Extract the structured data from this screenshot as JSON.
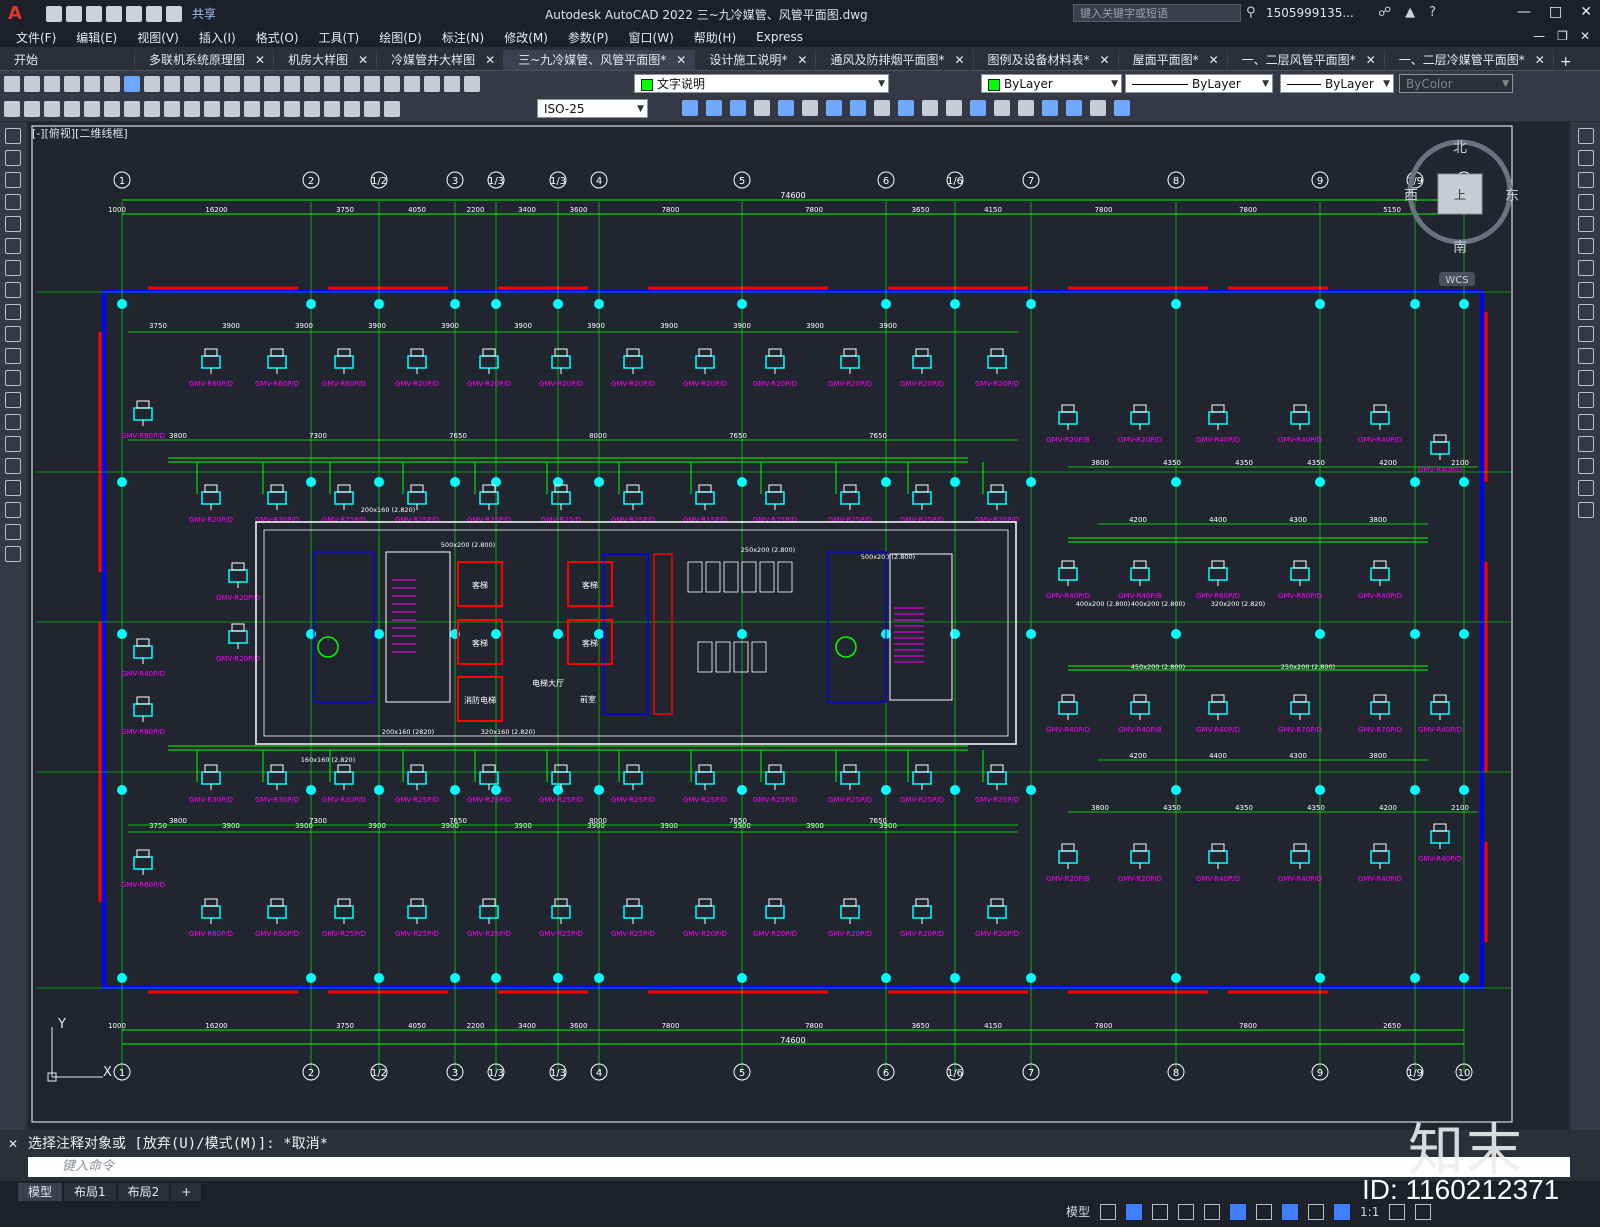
{
  "app": {
    "title": "Autodesk AutoCAD 2022   三~九冷媒管、风管平面图.dwg",
    "share": "共享",
    "search_placeholder": "键入关键字或短语",
    "user": "1505999135...",
    "logo_letter": "A"
  },
  "menu": [
    "文件(F)",
    "编辑(E)",
    "视图(V)",
    "插入(I)",
    "格式(O)",
    "工具(T)",
    "绘图(D)",
    "标注(N)",
    "修改(M)",
    "参数(P)",
    "窗口(W)",
    "帮助(H)",
    "Express"
  ],
  "tabs": [
    {
      "label": "开始",
      "closable": false,
      "active": false
    },
    {
      "label": "多联机系统原理图",
      "closable": true,
      "active": false
    },
    {
      "label": "机房大样图",
      "closable": true,
      "active": false
    },
    {
      "label": "冷媒管井大样图",
      "closable": true,
      "active": false
    },
    {
      "label": "三~九冷媒管、风管平面图*",
      "closable": true,
      "active": true
    },
    {
      "label": "设计施工说明*",
      "closable": true,
      "active": false
    },
    {
      "label": "通风及防排烟平面图*",
      "closable": true,
      "active": false
    },
    {
      "label": "图例及设备材料表*",
      "closable": true,
      "active": false
    },
    {
      "label": "屋面平面图*",
      "closable": true,
      "active": false
    },
    {
      "label": "一、二层风管平面图*",
      "closable": true,
      "active": false
    },
    {
      "label": "一、二层冷媒管平面图*",
      "closable": true,
      "active": false
    }
  ],
  "toolbar": {
    "layer": "文字说明",
    "color": "ByLayer",
    "linetype": "ByLayer",
    "lineweight": "ByLayer",
    "plotstyle": "ByColor",
    "dimstyle": "ISO-25"
  },
  "viewport": {
    "label": "[-][俯视][二维线框]",
    "compass": {
      "n": "北",
      "s": "南",
      "e": "东",
      "w": "西",
      "center": "上",
      "wcs": "WCS"
    }
  },
  "drawing": {
    "axis_labels": [
      "1",
      "2",
      "1/2",
      "3",
      "1/3",
      "1/3",
      "4",
      "5",
      "6",
      "1/6",
      "7",
      "8",
      "9",
      "1/9",
      "10"
    ],
    "top_overall_dim": "74600",
    "top_dims": [
      "1000",
      "16200",
      "3750",
      "4050",
      "2200",
      "3400",
      "3600",
      "7800",
      "7800",
      "3650",
      "4150",
      "7800",
      "7800",
      "5150"
    ],
    "bottom_dims": [
      "1000",
      "16200",
      "3750",
      "4050",
      "2200",
      "3400",
      "3600",
      "7800",
      "7800",
      "3650",
      "4150",
      "7800",
      "7800",
      "2650"
    ],
    "unit_labels_row1": [
      "GMV-R60P/D",
      "GMV-R60P/D",
      "GMV-R60P/D",
      "GMV-R20P/D",
      "GMV-R20P/D",
      "GMV-R20P/D",
      "GMV-R20P/D",
      "GMV-R20P/D",
      "GMV-R20P/D",
      "GMV-R20P/D",
      "GMV-R20P/D",
      "GMV-R20P/D"
    ],
    "unit_labels_right_top": [
      "GMV-R20P/B",
      "GMV-R20P/D",
      "GMV-R40P/D",
      "GMV-R40P/D",
      "GMV-R40P/D",
      "GMV-R40P/D"
    ],
    "unit_labels_row2": [
      "GMV-R20P/D",
      "GMV-R30P/D",
      "GMV-R25P/D",
      "GMV-R25P/D",
      "GMV-R25P/D",
      "GMV-R25/D",
      "GMV-R25P/D",
      "GMV-R15P/D",
      "GMV-R25P/D",
      "GMV-R25P/D",
      "GMV-R25P/D",
      "GMV-R25P/D"
    ],
    "unit_labels_right_mid": [
      "GMV-R40P/D",
      "GMV-R40P/B",
      "GMV-R60P/D",
      "GMV-R60P/D",
      "GMV-R40P/D"
    ],
    "unit_labels_right_low": [
      "GMV-R40P/D",
      "GMV-R40P/B",
      "GMV-R40P/D",
      "GMV-R70P/D",
      "GMV-R70P/D",
      "GMV-R40P/D"
    ],
    "unit_labels_row3": [
      "GMV-R30P/D",
      "GMV-R30P/D",
      "GMV-R30P/D",
      "GMV-R25P/D",
      "GMV-R25P/D",
      "GMV-R25P/D",
      "GMV-R25P/D",
      "GMV-R25P/D",
      "GMV-R25P/D",
      "GMV-R25P/D",
      "GMV-R25P/D",
      "GMV-R25P/D"
    ],
    "unit_labels_row4": [
      "GMV-R60P/D",
      "GMV-R50P/D",
      "GMV-R25P/D",
      "GMV-R25P/D",
      "GMV-R25P/D",
      "GMV-R25P/D",
      "GMV-R25P/D",
      "GMV-R20P/D",
      "GMV-R20P/D",
      "GMV-R20P/D",
      "GMV-R20P/D",
      "GMV-R20P/D"
    ],
    "unit_labels_right_bottom": [
      "GMV-R20P/B",
      "GMV-R20P/D",
      "GMV-R40P/D",
      "GMV-R40P/D",
      "GMV-R40P/D",
      "GMV-R40P/D"
    ],
    "left_units": [
      "GMV-R60P/D",
      "GMV-R60P/D",
      "GMV-R20P/D",
      "GMV-R20P/D",
      "GMV-R60P/D",
      "GMV-R40P/D"
    ],
    "duct_labels": [
      "500x200 (2.800)",
      "250x200 (2.800)",
      "200x160 (2.820)",
      "160x160 (2.820)",
      "400x200 (2.800)",
      "450x200 (2.800)",
      "500x200 (2.800)",
      "200x160 (2820)",
      "320x160 (2.820)",
      "400x200 (2.800)",
      "320x200 (2.820)",
      "250x200 (2.800)"
    ],
    "core_labels": [
      "客梯",
      "客梯",
      "消防电梯",
      "客梯",
      "客梯",
      "电梯大厅",
      "前室"
    ],
    "row_dims_top": [
      "3750",
      "3900",
      "3900",
      "3900",
      "3900",
      "3900",
      "3900",
      "3900",
      "3900",
      "3900",
      "3900"
    ],
    "row_dims_mid": [
      "3800",
      "7300",
      "7650",
      "8000",
      "7650",
      "7650"
    ],
    "right_dims": [
      "3800",
      "4350",
      "4350",
      "4350",
      "4200",
      "2100"
    ],
    "right_dims2": [
      "4200",
      "4400",
      "4300",
      "3800"
    ],
    "ucs_label_y": "Y",
    "ucs_label_x": "X"
  },
  "command": {
    "history": "选择注释对象或 [放弃(U)/模式(M)]: *取消*",
    "placeholder": "键入命令"
  },
  "layouts": [
    "模型",
    "布局1",
    "布局2"
  ],
  "statusbar": {
    "model": "模型",
    "scale": "1:1"
  },
  "watermark": {
    "id": "ID: 1160212371",
    "logo": "知末"
  },
  "colors": {
    "cyan": "#00ffff",
    "green": "#00ff00",
    "magenta": "#ff00ff",
    "blue": "#0000ff",
    "red": "#ff0000",
    "white": "#ffffff"
  }
}
